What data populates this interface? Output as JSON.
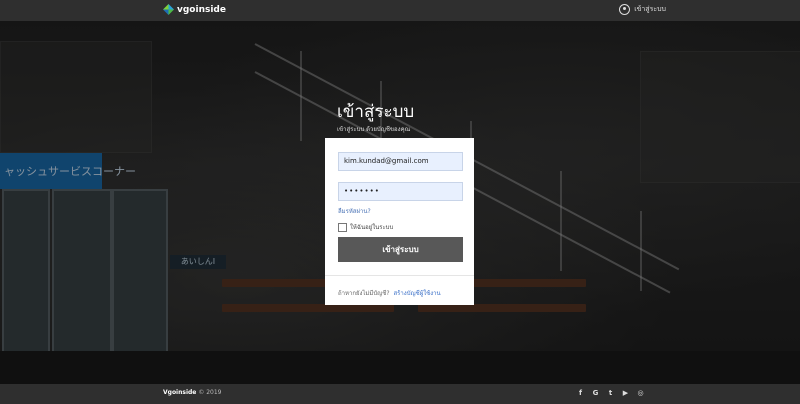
{
  "header": {
    "brand": "vgoinside",
    "login_link": "เข้าสู่ระบบ"
  },
  "background": {
    "shop_sign": "ャッシュサービスコーナー",
    "small_sign": "あいしんI"
  },
  "login": {
    "title": "เข้าสู่ระบบ",
    "subtitle": "เข้าสู่ระบบ ด้วยบัญชีของคุณ",
    "email_value": "kim.kundad@gmail.com",
    "password_value": "•••••••",
    "forgot_label": "ลืมรหัสผ่าน?",
    "remember_label": "ให้ฉันอยู่ในระบบ",
    "submit_label": "เข้าสู่ระบบ",
    "signup_prompt": "ถ้าหากยังไม่มีบัญชี?",
    "signup_link": "สร้างบัญชีผู้ใช้งาน"
  },
  "footer": {
    "brand": "Vgoinside",
    "year": "© 2019",
    "social": [
      {
        "icon": "facebook-icon",
        "glyph": "f"
      },
      {
        "icon": "google-icon",
        "glyph": "G"
      },
      {
        "icon": "twitter-icon",
        "glyph": "t"
      },
      {
        "icon": "youtube-icon",
        "glyph": "▶"
      },
      {
        "icon": "instagram-icon",
        "glyph": "◎"
      }
    ]
  },
  "colors": {
    "header_bg": "#2f2f2f",
    "button_bg": "#585858",
    "input_bg": "#e8f0fe",
    "link": "#3b70c8"
  }
}
